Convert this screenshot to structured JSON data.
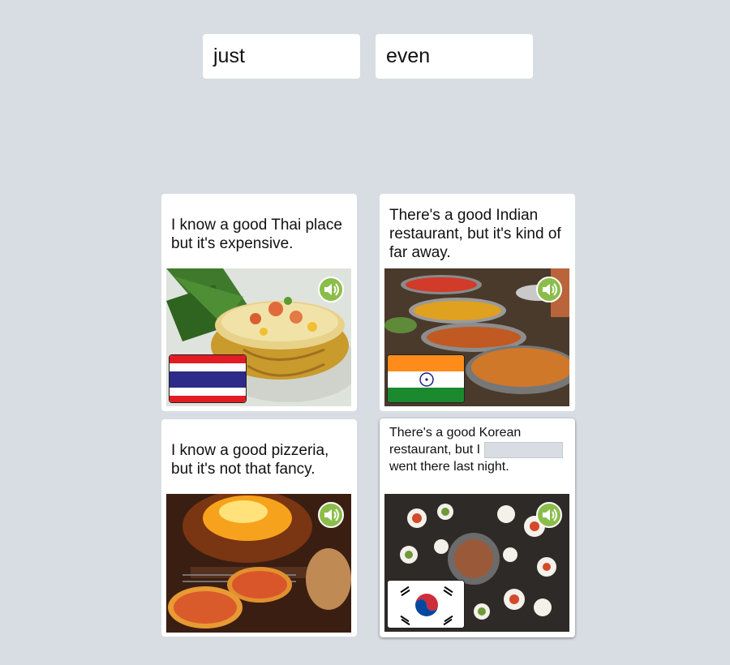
{
  "word_bank": [
    "just",
    "even"
  ],
  "cards": [
    {
      "text": "I know a good Thai place but it's expensive.",
      "photo": "thai-pineapple-fried-rice",
      "flag": "thailand-flag"
    },
    {
      "text": "There's a good Indian restaurant, but it's kind of far away.",
      "photo": "indian-curry-pots",
      "flag": "india-flag"
    },
    {
      "text": "I know a good pizzeria, but it's not that fancy.",
      "photo": "wood-fired-pizza",
      "flag": ""
    },
    {
      "text_before": "There's a good Korean restaurant, but I",
      "text_after": "went there last night.",
      "photo": "korean-bbq-table",
      "flag": "south-korea-flag"
    }
  ],
  "colors": {
    "background": "#d7dde2",
    "sound_button": "#8bbd4a"
  },
  "icons": {
    "sound": "speaker-icon"
  }
}
